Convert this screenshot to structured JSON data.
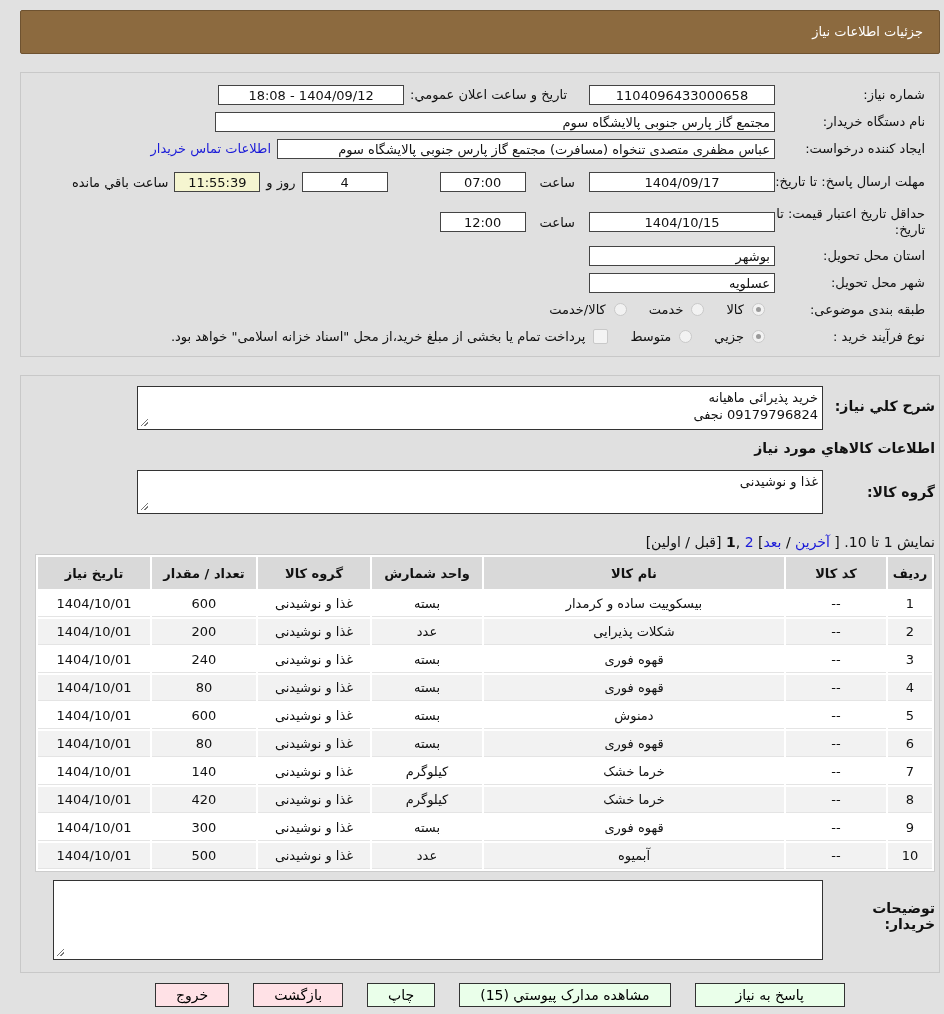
{
  "header": {
    "title": "جزئیات اطلاعات نیاز"
  },
  "info": {
    "need_number": {
      "label": "شماره نیاز:",
      "value": "1104096433000658"
    },
    "announce": {
      "label": "تاریخ و ساعت اعلان عمومي:",
      "value": "1404/09/12 - 18:08"
    },
    "buyer": {
      "label": "نام دستگاه خریدار:",
      "value": "مجتمع گاز پارس جنوبی  پالایشگاه سوم"
    },
    "requester": {
      "label": "ایجاد کننده درخواست:",
      "value": "عباس مظفری متصدی تنخواه (مسافرت) مجتمع گاز پارس جنوبی  پالایشگاه سوم",
      "link": "اطلاعات تماس خریدار"
    },
    "deadline": {
      "label": "مهلت ارسال پاسخ: تا تاریخ:",
      "date": "1404/09/17",
      "time_label": "ساعت",
      "time": "07:00",
      "days": "4",
      "days_suffix": "روز و",
      "remaining": "11:55:39",
      "remaining_suffix": "ساعت باقي مانده"
    },
    "validity": {
      "label": "حداقل تاریخ اعتبار قیمت: تا تاریخ:",
      "date": "1404/10/15",
      "time_label": "ساعت",
      "time": "12:00"
    },
    "province": {
      "label": "استان محل تحویل:",
      "value": "بوشهر"
    },
    "city": {
      "label": "شهر محل تحویل:",
      "value": "عسلویه"
    },
    "category": {
      "label": "طبقه بندی موضوعی:",
      "options": [
        {
          "label": "کالا",
          "selected": true
        },
        {
          "label": "خدمت",
          "selected": false
        },
        {
          "label": "کالا/خدمت",
          "selected": false
        }
      ]
    },
    "process": {
      "label": "نوع فرآیند خرید :",
      "options": [
        {
          "label": "جزيي",
          "selected": true
        },
        {
          "label": "متوسط",
          "selected": false
        }
      ],
      "checkbox": {
        "label": "پرداخت تمام یا بخشی از مبلغ خرید،از محل \"اسناد خزانه اسلامی\" خواهد بود.",
        "checked": false
      }
    }
  },
  "details": {
    "description": {
      "label": "شرح کلي نیاز:",
      "lines": [
        "خرید پذیرائی ماهیانه",
        "09179796824 نجفی"
      ]
    },
    "goods_heading": "اطلاعات کالاهاي مورد نیاز",
    "group": {
      "label": "گروه کالا:",
      "value": "غذا و نوشیدنی"
    },
    "pagination": {
      "lead": "نمایش 1 تا 10. [",
      "last": "آخرین",
      "sep": "/",
      "next": "بعد",
      "close": "]",
      "page2": "2",
      "comma": ",",
      "current": "1",
      "tail": "[قبل / اولین]"
    },
    "table": {
      "columns": [
        "ردیف",
        "کد کالا",
        "نام کالا",
        "واحد شمارش",
        "گروه کالا",
        "تعداد / مقدار",
        "تاریخ نیاز"
      ],
      "rows": [
        [
          "1",
          "--",
          "بیسکوییت ساده و کرمدار",
          "بسته",
          "غذا و نوشیدنی",
          "600",
          "1404/10/01"
        ],
        [
          "2",
          "--",
          "شکلات پذیرایی",
          "عدد",
          "غذا و نوشیدنی",
          "200",
          "1404/10/01"
        ],
        [
          "3",
          "--",
          "قهوه فوری",
          "بسته",
          "غذا و نوشیدنی",
          "240",
          "1404/10/01"
        ],
        [
          "4",
          "--",
          "قهوه فوری",
          "بسته",
          "غذا و نوشیدنی",
          "80",
          "1404/10/01"
        ],
        [
          "5",
          "--",
          "دمنوش",
          "بسته",
          "غذا و نوشیدنی",
          "600",
          "1404/10/01"
        ],
        [
          "6",
          "--",
          "قهوه فوری",
          "بسته",
          "غذا و نوشیدنی",
          "80",
          "1404/10/01"
        ],
        [
          "7",
          "--",
          "خرما خشک",
          "کیلوگرم",
          "غذا و نوشیدنی",
          "140",
          "1404/10/01"
        ],
        [
          "8",
          "--",
          "خرما خشک",
          "کیلوگرم",
          "غذا و نوشیدنی",
          "420",
          "1404/10/01"
        ],
        [
          "9",
          "--",
          "قهوه فوری",
          "بسته",
          "غذا و نوشیدنی",
          "300",
          "1404/10/01"
        ],
        [
          "10",
          "--",
          "آبمیوه",
          "عدد",
          "غذا و نوشیدنی",
          "500",
          "1404/10/01"
        ]
      ]
    },
    "notes": {
      "label": "توضیحات خریدار:"
    }
  },
  "buttons": [
    {
      "label": "پاسخ به نیاز",
      "kind": "action"
    },
    {
      "label": "مشاهده مدارک پیوستي (15)",
      "kind": "action"
    },
    {
      "label": "چاپ",
      "kind": "action"
    },
    {
      "label": "بازگشت",
      "kind": "exit"
    },
    {
      "label": "خروج",
      "kind": "exit"
    }
  ]
}
